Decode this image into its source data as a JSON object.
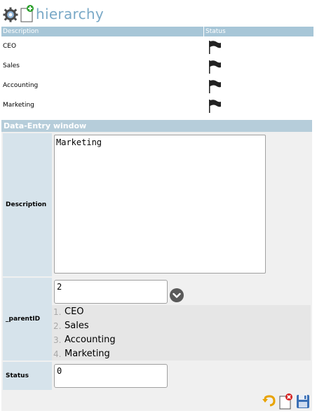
{
  "header": {
    "title": "hierarchy",
    "icons": [
      "gear-icon",
      "new-document-icon"
    ]
  },
  "list": {
    "columns": {
      "description": "Description",
      "status": "Status"
    },
    "rows": [
      {
        "description": "CEO",
        "status_icon": "flag-icon"
      },
      {
        "description": "Sales",
        "status_icon": "flag-icon"
      },
      {
        "description": "Accounting",
        "status_icon": "flag-icon"
      },
      {
        "description": "Marketing",
        "status_icon": "flag-icon"
      }
    ]
  },
  "form": {
    "title": "Data-Entry window",
    "description": {
      "label": "Description",
      "value": "Marketing"
    },
    "parent": {
      "label": "_parentID",
      "value": "2",
      "options": [
        {
          "num": "1.",
          "label": "CEO"
        },
        {
          "num": "2.",
          "label": "Sales"
        },
        {
          "num": "3.",
          "label": "Accounting"
        },
        {
          "num": "4.",
          "label": "Marketing"
        }
      ]
    },
    "status": {
      "label": "Status",
      "value": "0"
    },
    "actions": [
      "undo-icon",
      "delete-document-icon",
      "save-icon"
    ]
  },
  "colors": {
    "header_blue": "#a7c6d7",
    "title_blue": "#7aa9c7",
    "label_bg": "#d6e3eb"
  }
}
